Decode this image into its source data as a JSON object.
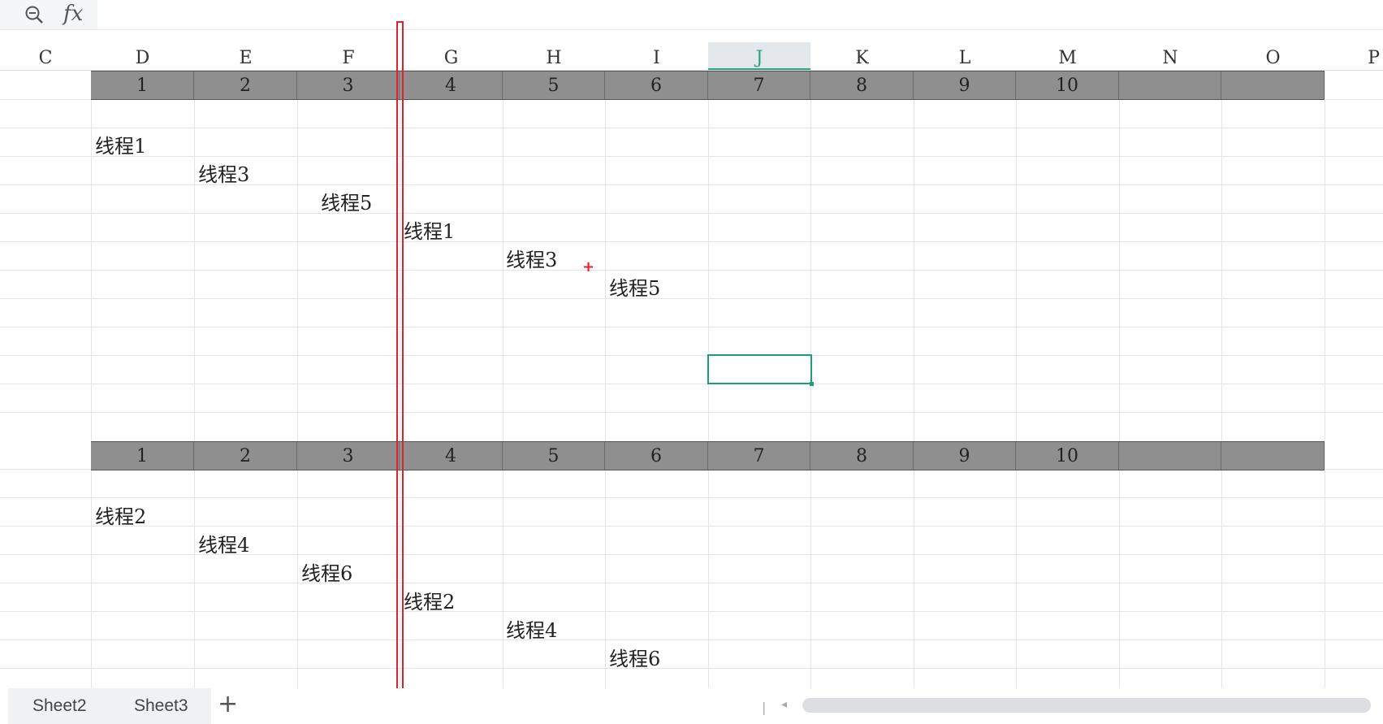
{
  "formula_bar": {
    "zoom_icon": "zoom-in-icon",
    "fx_label": "fx",
    "value": ""
  },
  "columns": [
    "C",
    "D",
    "E",
    "F",
    "G",
    "H",
    "I",
    "J",
    "K",
    "L",
    "M",
    "N",
    "O",
    "P"
  ],
  "active_column": "J",
  "header_rows": [
    {
      "cells": [
        "1",
        "2",
        "3",
        "4",
        "5",
        "6",
        "7",
        "8",
        "9",
        "10",
        "",
        ""
      ]
    },
    {
      "cells": [
        "1",
        "2",
        "3",
        "4",
        "5",
        "6",
        "7",
        "8",
        "9",
        "10",
        "",
        ""
      ]
    }
  ],
  "threads_block_1": [
    "线程1",
    "线程3",
    "线程5",
    "线程1",
    "线程3",
    "线程5"
  ],
  "threads_block_2": [
    "线程2",
    "线程4",
    "线程6",
    "线程2",
    "线程4",
    "线程6"
  ],
  "sheet_tabs": [
    "Sheet2",
    "Sheet3"
  ],
  "add_sheet_label": "+",
  "colors": {
    "header_fill": "#8f8f8f",
    "selection": "#1f9e72",
    "marker": "#e0202a"
  }
}
